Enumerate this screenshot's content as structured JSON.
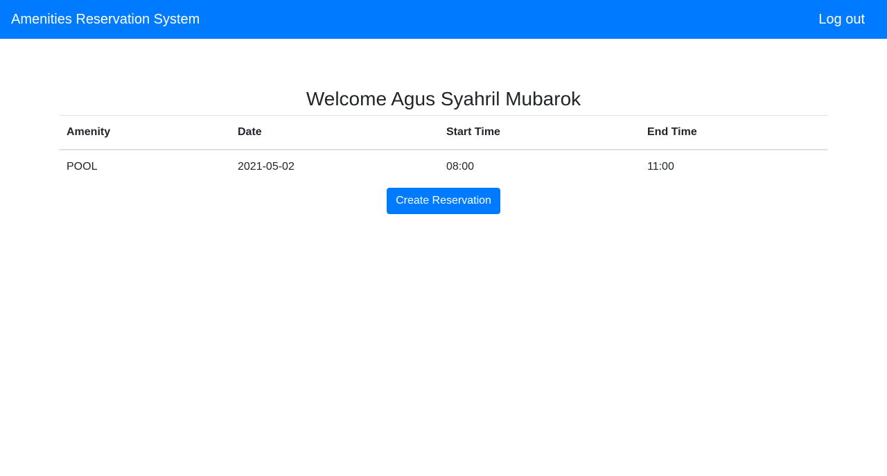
{
  "navbar": {
    "brand": "Amenities Reservation System",
    "logout_label": "Log out",
    "background_color": "#007bff"
  },
  "main": {
    "welcome_text": "Welcome Agus Syahril Mubarok",
    "table": {
      "headers": [
        "Amenity",
        "Date",
        "Start Time",
        "End Time"
      ],
      "rows": [
        [
          "POOL",
          "2021-05-02",
          "08:00",
          "11:00"
        ]
      ]
    },
    "create_button_label": "Create Reservation"
  }
}
